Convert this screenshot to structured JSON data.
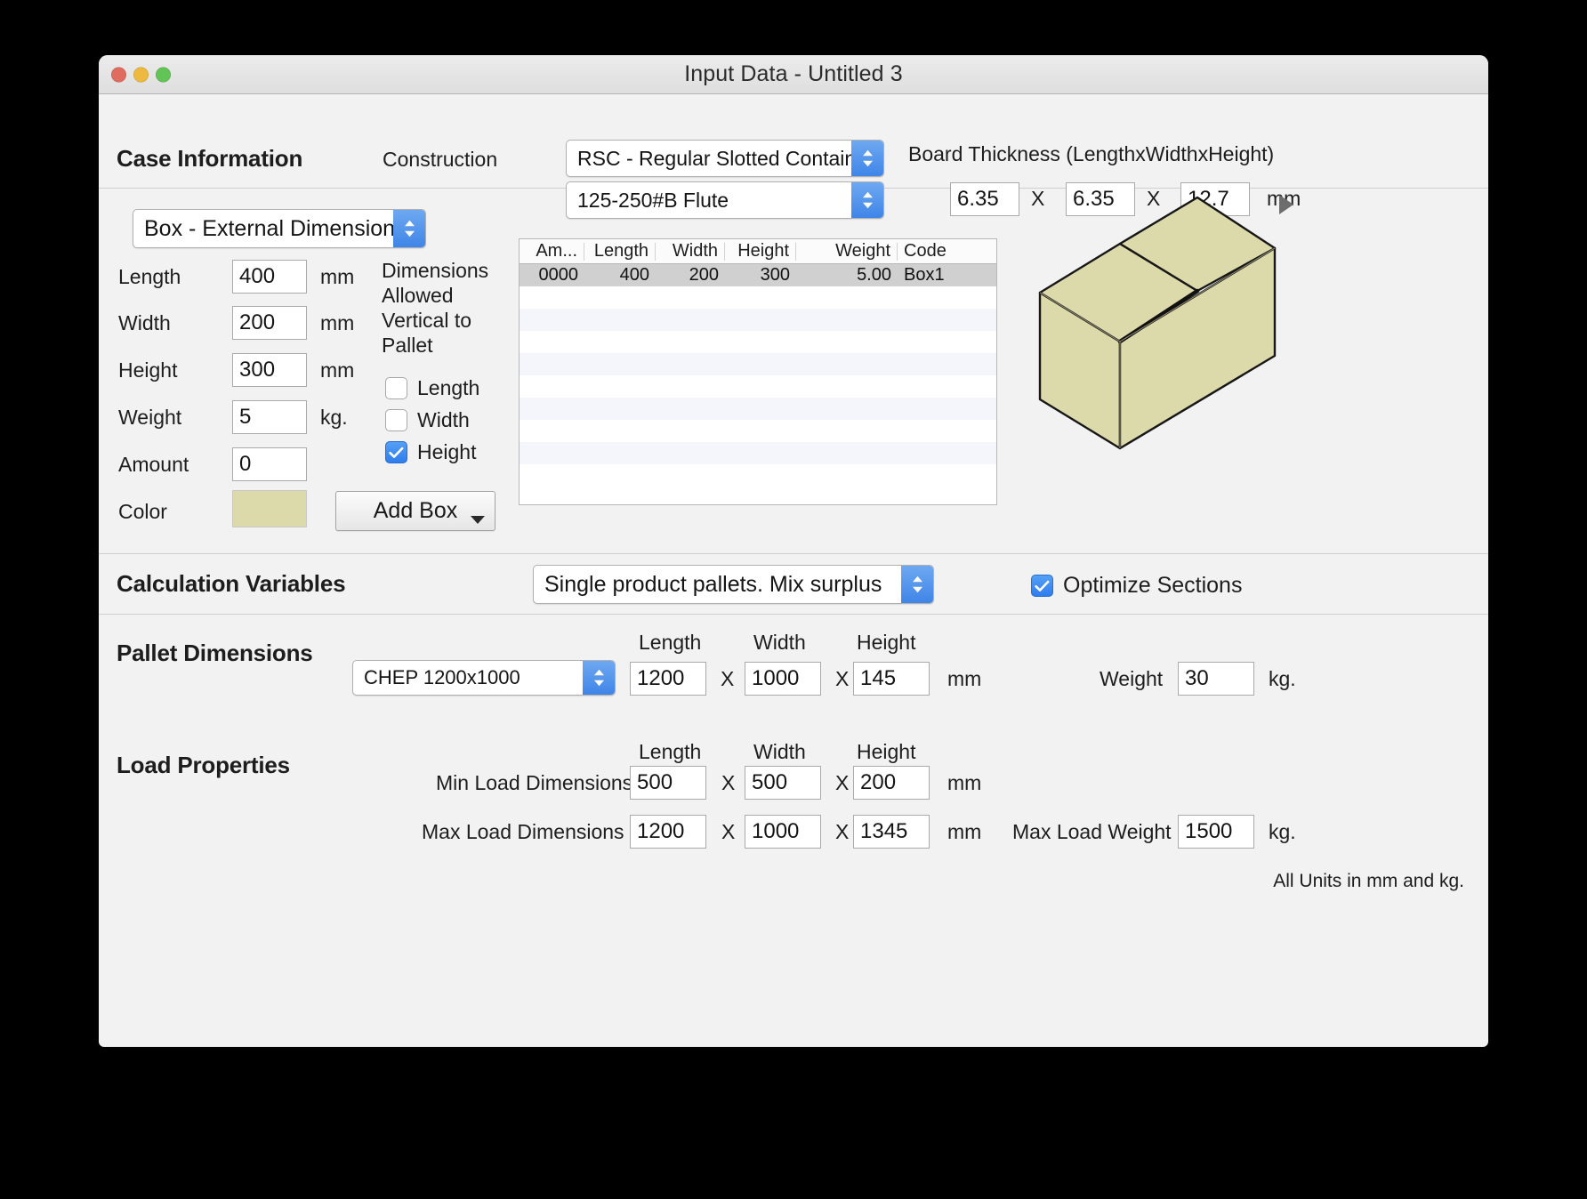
{
  "window": {
    "title": "Input Data - Untitled 3",
    "traffic": {
      "close": "close-button",
      "minimize": "minimize-button",
      "maximize": "maximize-button"
    }
  },
  "case_information": {
    "heading": "Case Information",
    "construction_label": "Construction",
    "construction_value": "RSC - Regular Slotted Container",
    "flute_value": "125-250#B Flute",
    "board_thickness_label": "Board Thickness (LengthxWidthxHeight)",
    "board_length": "6.35",
    "board_width": "6.35",
    "board_height": "12.7",
    "separator": "X",
    "units": "mm"
  },
  "box_panel": {
    "mode_value": "Box - External Dimensions",
    "disclosure": "disclosure-triangle",
    "fields": [
      {
        "label": "Length",
        "value": "400",
        "unit": "mm"
      },
      {
        "label": "Width",
        "value": "200",
        "unit": "mm"
      },
      {
        "label": "Height",
        "value": "300",
        "unit": "mm"
      },
      {
        "label": "Weight",
        "value": "5",
        "unit": "kg."
      },
      {
        "label": "Amount",
        "value": "0",
        "unit": ""
      }
    ],
    "color_label": "Color",
    "color_value": "#dcd9ab",
    "add_box_label": "Add Box",
    "vertical_note": "Dimensions Allowed Vertical to Pallet",
    "vertical_note_lines": [
      "Dimensions",
      "Allowed",
      "Vertical to",
      "Pallet"
    ],
    "vertical_checks": [
      {
        "label": "Length",
        "checked": false
      },
      {
        "label": "Width",
        "checked": false
      },
      {
        "label": "Height",
        "checked": true
      }
    ],
    "table": {
      "columns": [
        "Am...",
        "Length",
        "Width",
        "Height",
        "Weight",
        "Code"
      ],
      "rows": [
        {
          "amount": "0000",
          "length": "400",
          "width": "200",
          "height": "300",
          "weight": "5.00",
          "code": "Box1",
          "selected": true
        }
      ],
      "empty_row_count": 9
    },
    "preview": {
      "name": "box-3d-preview",
      "fill": "#dcd9ab",
      "stroke": "#171717"
    }
  },
  "calculation_variables": {
    "heading": "Calculation Variables",
    "mode_value": "Single product pallets. Mix surplus",
    "optimize_label": "Optimize Sections",
    "optimize_checked": true
  },
  "pallet_dimensions": {
    "heading": "Pallet Dimensions",
    "pallet_value": "CHEP 1200x1000",
    "col_length": "Length",
    "col_width": "Width",
    "col_height": "Height",
    "length": "1200",
    "width": "1000",
    "height": "145",
    "separator": "X",
    "units": "mm",
    "weight_label": "Weight",
    "weight": "30",
    "weight_units": "kg."
  },
  "load_properties": {
    "heading": "Load Properties",
    "col_length": "Length",
    "col_width": "Width",
    "col_height": "Height",
    "min_label": "Min Load Dimensions",
    "min_length": "500",
    "min_width": "500",
    "min_height": "200",
    "max_label": "Max Load Dimensions",
    "max_length": "1200",
    "max_width": "1000",
    "max_height": "1345",
    "separator": "X",
    "units": "mm",
    "max_weight_label": "Max Load Weight",
    "max_weight": "1500",
    "max_weight_units": "kg.",
    "footnote": "All Units in mm and kg."
  },
  "colors": {
    "accent": "#3f85e8",
    "window_bg": "#f2f2f2",
    "box_fill": "#dcd9ab"
  }
}
